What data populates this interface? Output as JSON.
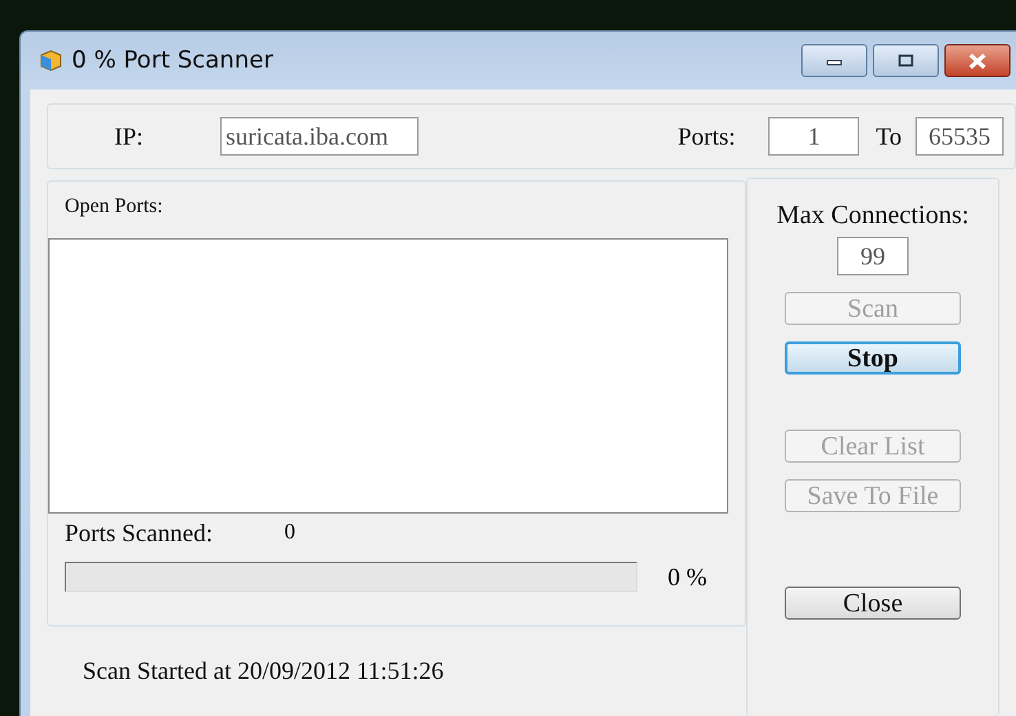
{
  "window": {
    "title": "0 % Port Scanner"
  },
  "target": {
    "ip_label": "IP:",
    "ip_value": "suricata.iba.com",
    "ports_label": "Ports:",
    "port_from": "1",
    "to_label": "To",
    "port_to": "65535"
  },
  "open_ports": {
    "label": "Open Ports:"
  },
  "scanned": {
    "label": "Ports Scanned:",
    "count": "0"
  },
  "progress": {
    "level": 0,
    "reading": "0 %"
  },
  "status": "Scan Started at 20/09/2012 11:51:26",
  "max_connections": {
    "label": "Max Connections:",
    "value": "99"
  },
  "buttons": [
    {
      "label": "Scan",
      "disabled": true,
      "focused": false,
      "kind": "action"
    },
    {
      "label": "Stop",
      "disabled": false,
      "focused": true,
      "kind": "action"
    },
    {
      "label": "Clear List",
      "disabled": true,
      "focused": false,
      "kind": "gap"
    },
    {
      "label": "Save To File",
      "disabled": true,
      "focused": false,
      "kind": "action"
    },
    {
      "label": "Close",
      "disabled": false,
      "focused": false,
      "kind": "bottom"
    }
  ]
}
